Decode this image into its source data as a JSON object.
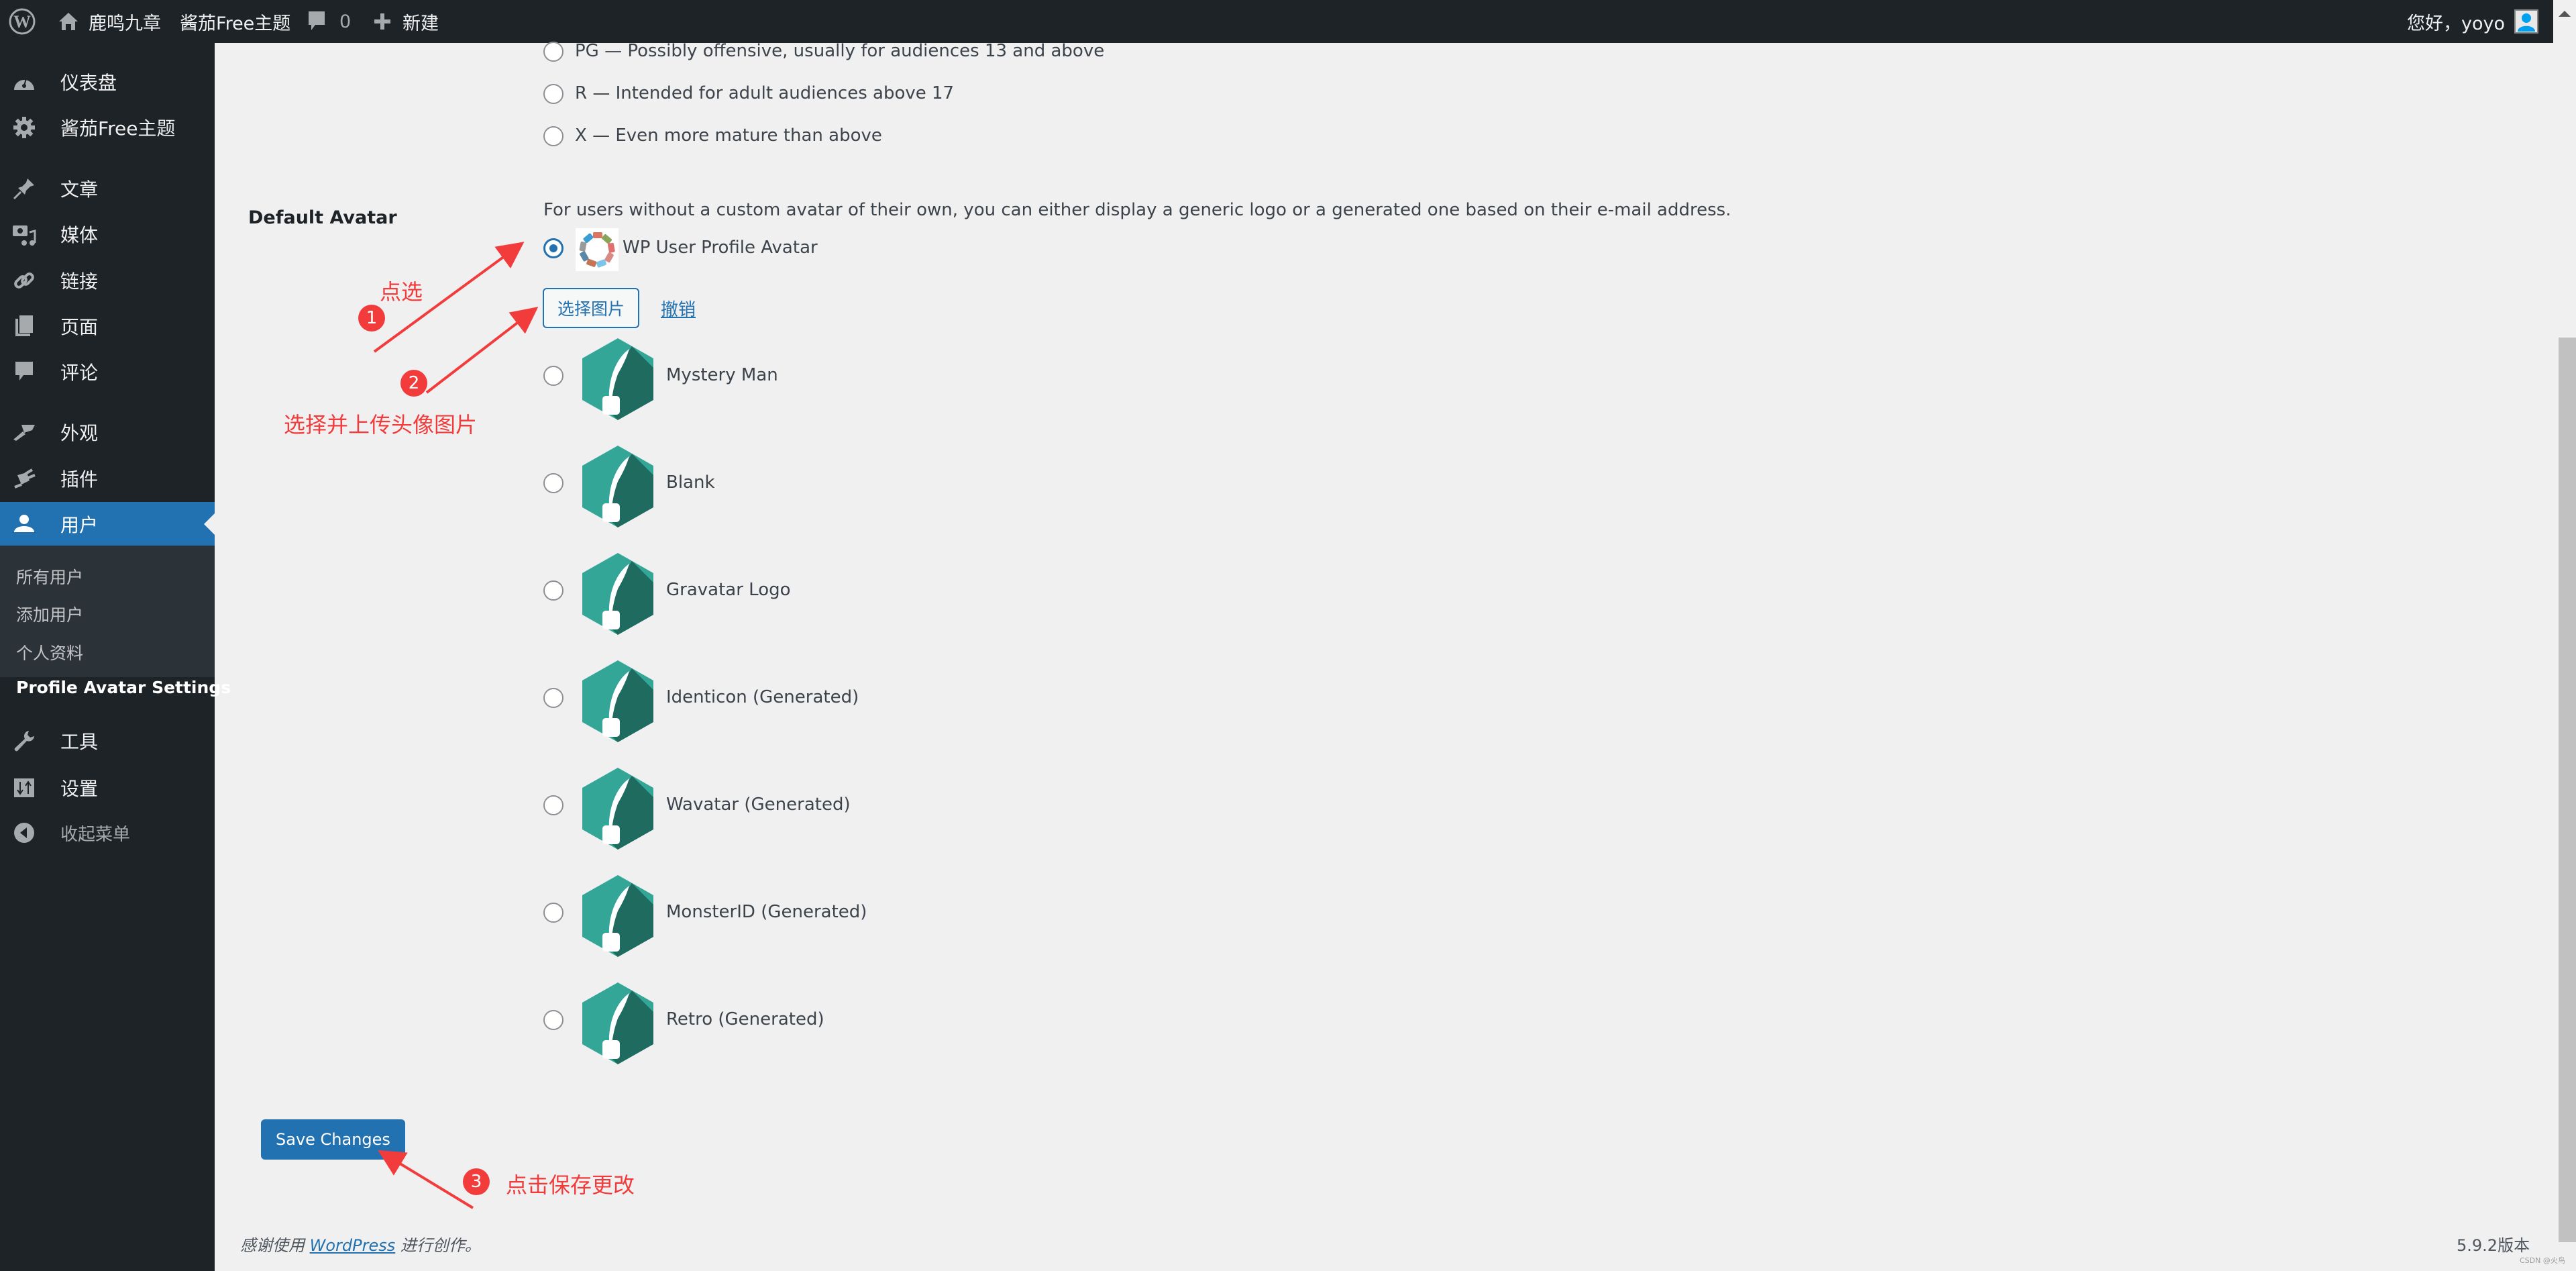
{
  "adminbar": {
    "site_name": "鹿鸣九章",
    "theme_link": "酱茄Free主题",
    "comments_count": "0",
    "new_label": "新建",
    "greeting": "您好，yoyo"
  },
  "sidebar": {
    "items": [
      {
        "label": "仪表盘",
        "icon": "dashboard-icon"
      },
      {
        "label": "酱茄Free主题",
        "icon": "gear-icon"
      },
      {
        "label": "文章",
        "icon": "pin-icon"
      },
      {
        "label": "媒体",
        "icon": "media-icon"
      },
      {
        "label": "链接",
        "icon": "link-icon"
      },
      {
        "label": "页面",
        "icon": "pages-icon"
      },
      {
        "label": "评论",
        "icon": "comment-icon"
      },
      {
        "label": "外观",
        "icon": "brush-icon"
      },
      {
        "label": "插件",
        "icon": "plugin-icon"
      },
      {
        "label": "用户",
        "icon": "user-icon",
        "active": true
      },
      {
        "label": "工具",
        "icon": "wrench-icon"
      },
      {
        "label": "设置",
        "icon": "settings-icon"
      }
    ],
    "submenu": [
      {
        "label": "所有用户"
      },
      {
        "label": "添加用户"
      },
      {
        "label": "个人资料"
      },
      {
        "label": "Profile Avatar Settings",
        "current": true
      }
    ],
    "collapse_label": "收起菜单"
  },
  "rating": {
    "options": [
      {
        "label": "PG — Possibly offensive, usually for audiences 13 and above",
        "checked": false
      },
      {
        "label": "R — Intended for adult audiences above 17",
        "checked": false
      },
      {
        "label": "X — Even more mature than above",
        "checked": false
      }
    ]
  },
  "default_avatar": {
    "label": "Default Avatar",
    "description": "For users without a custom avatar of their own, you can either display a generic logo or a generated one based on their e-mail address.",
    "custom_option": {
      "label": "WP User Profile Avatar",
      "checked": true
    },
    "choose_image_button": "选择图片",
    "undo_link": "撤销",
    "options": [
      {
        "label": "Mystery Man",
        "checked": false
      },
      {
        "label": "Blank",
        "checked": false
      },
      {
        "label": "Gravatar Logo",
        "checked": false
      },
      {
        "label": "Identicon (Generated)",
        "checked": false
      },
      {
        "label": "Wavatar (Generated)",
        "checked": false
      },
      {
        "label": "MonsterID (Generated)",
        "checked": false
      },
      {
        "label": "Retro (Generated)",
        "checked": false
      }
    ]
  },
  "save_button": "Save Changes",
  "footer": {
    "thanks_prefix": "感谢使用",
    "wordpress_link": "WordPress",
    "thanks_suffix": "进行创作。",
    "version": "5.9.2版本"
  },
  "annotations": [
    {
      "number": "1",
      "text": "点选"
    },
    {
      "number": "2",
      "text": "选择并上传头像图片"
    },
    {
      "number": "3",
      "text": "点击保存更改"
    }
  ],
  "watermark": "CSDN @火鸟",
  "colors": {
    "admin_bg": "#1d2327",
    "accent": "#2271b1",
    "annotation": "#f23c3c",
    "hex_light": "#33a698",
    "hex_dark": "#1f6b60"
  }
}
